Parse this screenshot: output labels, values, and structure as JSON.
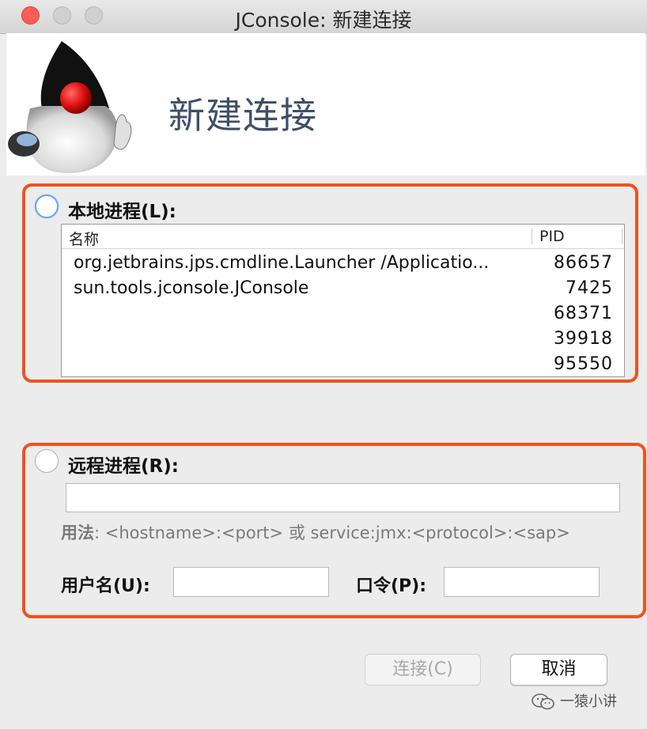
{
  "window": {
    "title": "JConsole: 新建连接",
    "traffic_lights": {
      "close_color": "#fc5c56"
    }
  },
  "header": {
    "title": "新建连接",
    "logo_icon": "java-duke-icon"
  },
  "local": {
    "label": "本地进程(L):",
    "selected": false,
    "columns": {
      "name": "名称",
      "pid": "PID"
    },
    "processes": [
      {
        "name": "org.jetbrains.jps.cmdline.Launcher /Applicatio...",
        "pid": "86657"
      },
      {
        "name": "sun.tools.jconsole.JConsole",
        "pid": "7425"
      },
      {
        "name": "",
        "pid": "68371"
      },
      {
        "name": "",
        "pid": "39918"
      },
      {
        "name": "",
        "pid": "95550"
      }
    ]
  },
  "remote": {
    "label": "远程进程(R):",
    "selected": false,
    "address_value": "",
    "usage_prefix": "用法",
    "usage_text": ": <hostname>:<port> 或 service:jmx:<protocol>:<sap>",
    "username_label": "用户名(U):",
    "username_value": "",
    "password_label": "口令(P):",
    "password_value": ""
  },
  "buttons": {
    "connect": "连接(C)",
    "connect_enabled": false,
    "cancel": "取消"
  },
  "watermark": {
    "text": "一猿小讲",
    "icon": "wechat-icon"
  },
  "colors": {
    "highlight_frame": "#f0521d",
    "header_title": "#3f4f67",
    "radio_focus": "#6aa6e6"
  }
}
